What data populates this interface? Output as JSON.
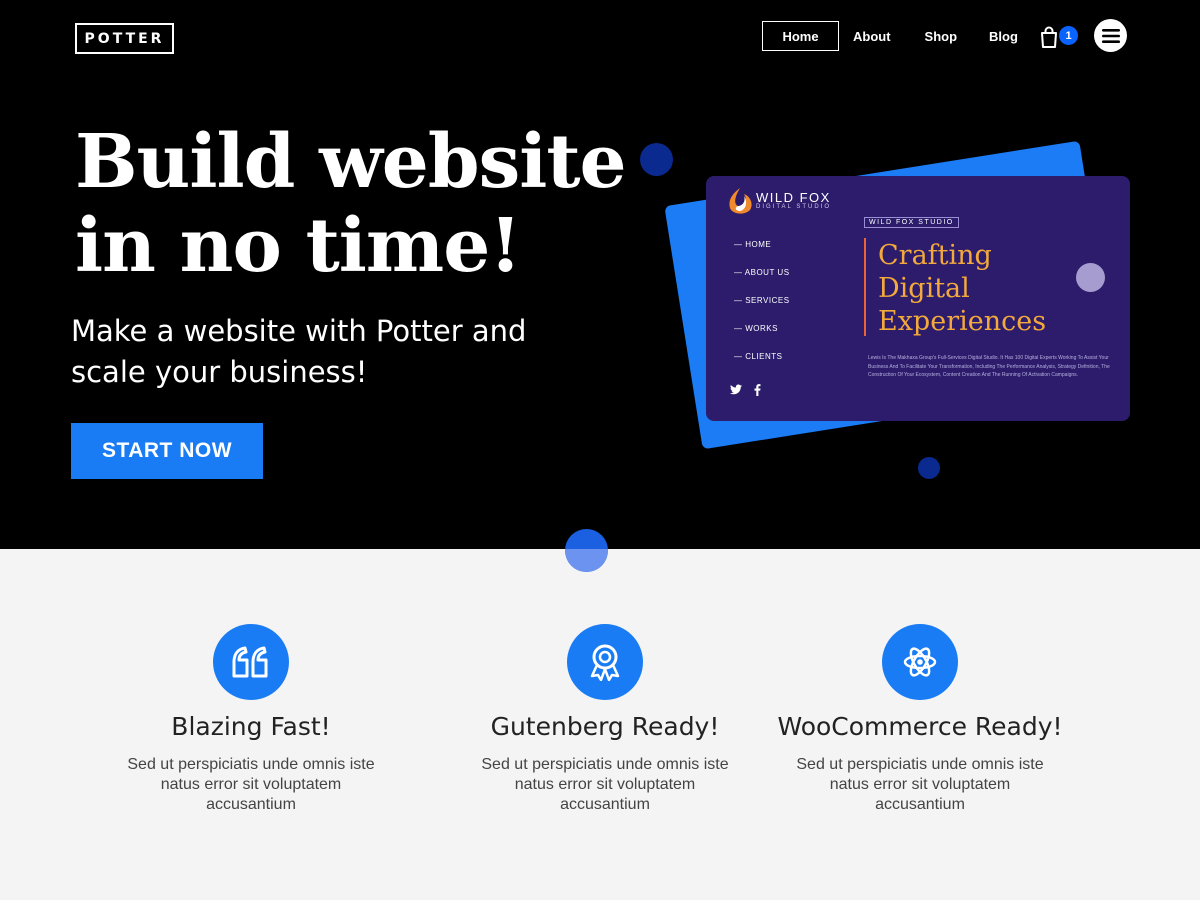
{
  "header": {
    "logo": "POTTER",
    "nav": [
      "Home",
      "About",
      "Shop",
      "Blog"
    ],
    "cart_count": "1"
  },
  "hero": {
    "headline_line1": "Build website",
    "headline_line2": "in no time!",
    "subhead": "Make a website with Potter and scale your business!",
    "cta": "START NOW"
  },
  "preview_card": {
    "brand": "WILD FOX",
    "brand_sub": "DIGITAL STUDIO",
    "menu": [
      "— HOME",
      "— ABOUT US",
      "— SERVICES",
      "— WORKS",
      "— CLIENTS"
    ],
    "studio_tag": "WILD FOX STUDIO",
    "heading": [
      "Crafting",
      "Digital",
      "Experiences"
    ],
    "body": "Lewis Is The Makhaxa Group's Full-Services Digital Studio. It Has 100 Digital Experts Working To Assist Your Business And To Facilitate Your Transformation, Including The Performance Analysis, Strategy Definition, The Construction Of Your Ecosystem, Content Creation And The Running Of Activation Campaigns."
  },
  "features": [
    {
      "title": "Blazing Fast!",
      "desc": "Sed ut perspiciatis unde omnis iste natus error sit voluptatem accusantium",
      "icon": "quote-icon"
    },
    {
      "title": "Gutenberg Ready!",
      "desc": "Sed ut perspiciatis unde omnis iste natus error sit voluptatem accusantium",
      "icon": "award-icon"
    },
    {
      "title": "WooCommerce Ready!",
      "desc": "Sed ut perspiciatis unde omnis iste natus error sit voluptatem accusantium",
      "icon": "atom-icon"
    }
  ],
  "colors": {
    "accent": "#1a7cf5",
    "hero_bg": "#000000",
    "section_bg": "#f4f4f4",
    "card_bg": "#2c1c6b",
    "card_heading": "#f3a93c"
  }
}
